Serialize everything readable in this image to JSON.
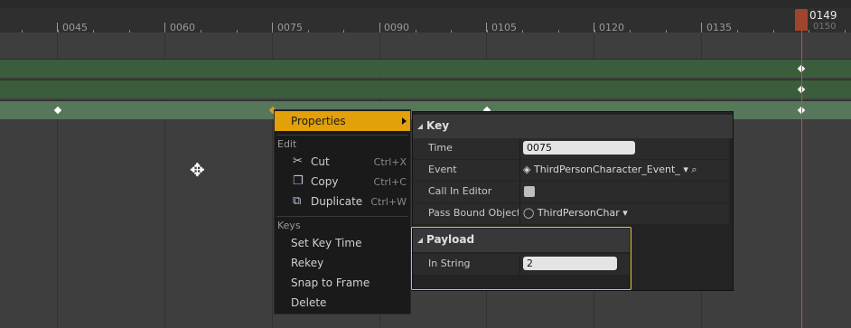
{
  "timeline": {
    "ticks": [
      "0045",
      "0060",
      "0075",
      "0090",
      "0105",
      "0120",
      "0135"
    ],
    "playhead_frame": "0149",
    "next_frame": "0150"
  },
  "context_menu": {
    "properties_label": "Properties",
    "edit_section": "Edit",
    "edit_items": [
      {
        "label": "Cut",
        "shortcut": "Ctrl+X",
        "icon": "scissors-icon"
      },
      {
        "label": "Copy",
        "shortcut": "Ctrl+C",
        "icon": "copy-icon"
      },
      {
        "label": "Duplicate",
        "shortcut": "Ctrl+W",
        "icon": "duplicate-icon"
      }
    ],
    "keys_section": "Keys",
    "key_items": [
      "Set Key Time",
      "Rekey",
      "Snap to Frame",
      "Delete"
    ]
  },
  "properties_panel": {
    "key_header": "Key",
    "time_label": "Time",
    "time_value": "0075",
    "event_label": "Event",
    "event_value": "ThirdPersonCharacter_Event_",
    "call_in_editor_label": "Call In Editor",
    "pass_bound_label": "Pass Bound Object T",
    "pass_bound_value": "ThirdPersonChar",
    "payload_header": "Payload",
    "in_string_label": "In String",
    "in_string_value": "2"
  }
}
